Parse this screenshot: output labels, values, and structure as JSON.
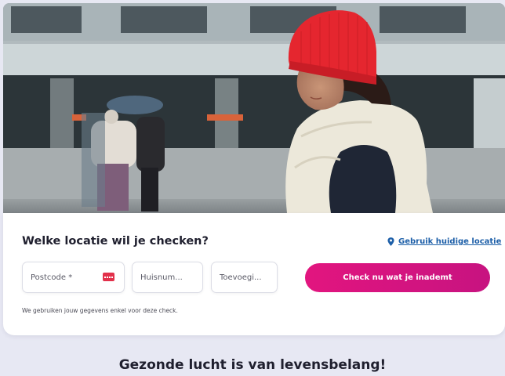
{
  "hero": {
    "image": "photo-woman-red-beanie-cream-scarf-street",
    "hat_color": "#e5262f",
    "scarf_color": "#ece8da"
  },
  "form": {
    "title": "Welke locatie wil je checken?",
    "location_link": "Gebruik huidige locatie",
    "location_icon": "map-pin-icon",
    "postcode": {
      "placeholder": "Postcode *",
      "icon": "keyboard-icon"
    },
    "huisnummer": {
      "placeholder": "Huisnum..."
    },
    "toevoeging": {
      "placeholder": "Toevoegi..."
    },
    "submit_label": "Check nu wat je inademt",
    "privacy_note": "We gebruiken jouw gegevens enkel voor deze check."
  },
  "section": {
    "title": "Gezonde lucht is van levensbelang!"
  },
  "colors": {
    "accent": "#e2157f",
    "link": "#1d5fa8",
    "page_bg": "#e7e8f3"
  }
}
